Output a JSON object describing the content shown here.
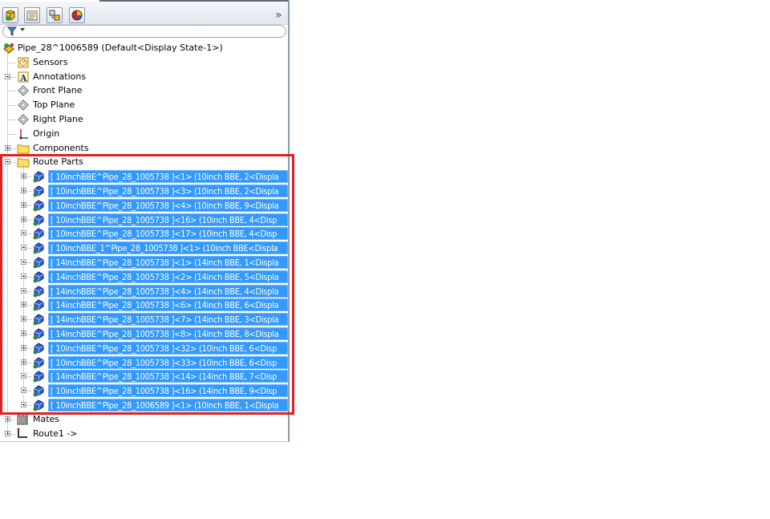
{
  "toolbar": {
    "buttons": [
      "feature-manager-tree-icon",
      "property-manager-icon",
      "configuration-manager-icon",
      "display-manager-icon"
    ],
    "overflow": "»"
  },
  "filter": {
    "icon": "funnel-icon"
  },
  "tree": {
    "root": "Pipe_28^1006589  (Default<Display State-1>)",
    "items": [
      {
        "label": "Sensors",
        "icon": "sensor-icon"
      },
      {
        "label": "Annotations",
        "icon": "annotations-icon"
      },
      {
        "label": "Front Plane",
        "icon": "plane-icon"
      },
      {
        "label": "Top Plane",
        "icon": "plane-icon"
      },
      {
        "label": "Right Plane",
        "icon": "plane-icon"
      },
      {
        "label": "Origin",
        "icon": "origin-icon"
      },
      {
        "label": "Components",
        "icon": "folder-icon"
      },
      {
        "label": "Route Parts",
        "icon": "folder-icon"
      }
    ],
    "route_parts": [
      "[ 10inchBBE^Pipe_28_1005738 ]<1> (10inch BBE, 2<Displa",
      "[ 10inchBBE^Pipe_28_1005738 ]<3> (10inch BBE, 2<Displa",
      "[ 10inchBBE^Pipe_28_1005738 ]<4> (10inch BBE, 9<Displa",
      "[ 10inchBBE^Pipe_28_1005738 ]<16> (10inch BBE, 4<Disp",
      "[ 10inchBBE^Pipe_28_1005738 ]<17> (10inch BBE, 4<Disp",
      "[ 10inchBBE_1^Pipe_28_1005738 ]<1> (10inch BBE<Displa",
      "[ 14inchBBE^Pipe_28_1005738 ]<1> (14inch BBE, 1<Displa",
      "[ 14inchBBE^Pipe_28_1005738 ]<2> (14inch BBE, 5<Displa",
      "[ 14inchBBE^Pipe_28_1005738 ]<4> (14inch BBE, 4<Displa",
      "[ 14inchBBE^Pipe_28_1005738 ]<6> (14inch BBE, 6<Displa",
      "[ 14inchBBE^Pipe_28_1005738 ]<7> (14inch BBE, 3<Displa",
      "[ 14inchBBE^Pipe_28_1005738 ]<8> (14inch BBE, 8<Displa",
      "[ 10inchBBE^Pipe_28_1005738 ]<32> (10inch BBE, 6<Disp",
      "[ 10inchBBE^Pipe_28_1005738 ]<33> (10inch BBE, 6<Disp",
      "[ 14inchBBE^Pipe_28_1005738 ]<14> (14inch BBE, 7<Disp",
      "[ 10inchBBE^Pipe_28_1005738 ]<16> (14inch BBE, 9<Disp",
      "[ 10inchBBE^Pipe_28_1006589 ]<1> (10inch BBE, 1<Displa"
    ],
    "after": [
      {
        "label": "Mates",
        "icon": "mates-icon"
      },
      {
        "label": "Route1 ->",
        "icon": "route-icon"
      }
    ]
  },
  "colors": {
    "selection": "#3399ff",
    "highlight_box": "#e02020"
  }
}
